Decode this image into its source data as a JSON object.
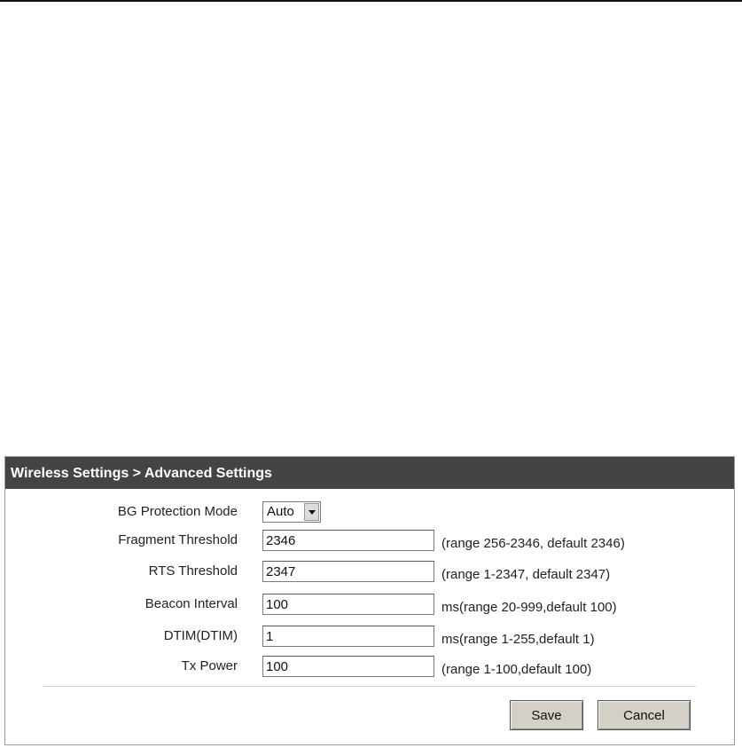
{
  "panel": {
    "title": "Wireless Settings > Advanced Settings"
  },
  "fields": {
    "bg_protection": {
      "label": "BG Protection Mode",
      "value": "Auto"
    },
    "fragment_threshold": {
      "label": "Fragment Threshold",
      "value": "2346",
      "hint": "(range 256-2346, default 2346)"
    },
    "rts_threshold": {
      "label": "RTS Threshold",
      "value": "2347",
      "hint": "(range 1-2347, default 2347)"
    },
    "beacon_interval": {
      "label": "Beacon Interval",
      "value": "100",
      "hint": "ms(range 20-999,default 100)"
    },
    "dtim": {
      "label": "DTIM(DTIM)",
      "value": "1",
      "hint": "ms(range 1-255,default 1)"
    },
    "tx_power": {
      "label": "Tx Power",
      "value": "100",
      "hint": "(range 1-100,default 100)"
    }
  },
  "buttons": {
    "save": "Save",
    "cancel": "Cancel"
  },
  "icons": {
    "dropdown": "chevron-down-icon"
  }
}
